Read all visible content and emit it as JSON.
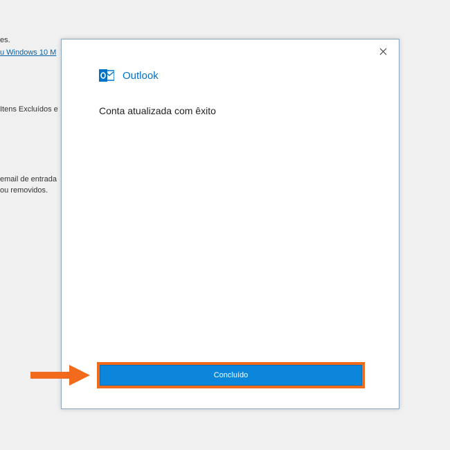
{
  "background": {
    "lines": [
      "es.",
      "u Windows 10 M",
      "Itens Excluídos e",
      "email de entrada",
      " ou removidos."
    ]
  },
  "dialog": {
    "app_name": "Outlook",
    "message": "Conta atualizada com êxito",
    "done_label": "Concluído"
  },
  "colors": {
    "accent": "#0072c6",
    "button": "#0b86db",
    "highlight": "#f26b1d"
  }
}
